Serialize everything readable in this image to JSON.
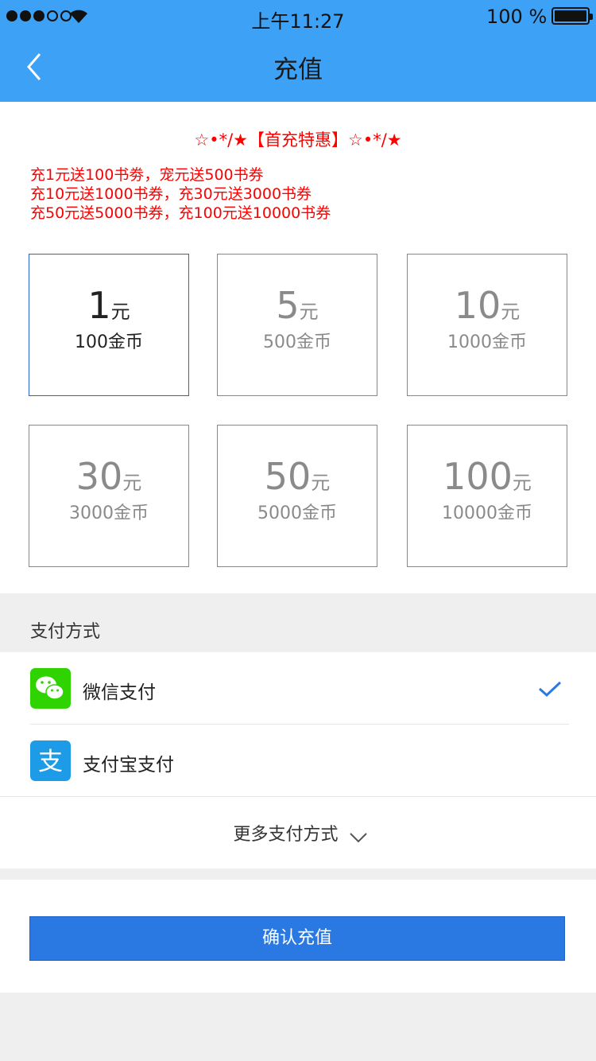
{
  "status_bar": {
    "time": "上午11:27",
    "battery_percent": "100 %",
    "signal_bars_filled": 3,
    "signal_bars_total": 5
  },
  "nav": {
    "title": "充值",
    "back_icon": "chevron-left-icon"
  },
  "promo": {
    "title": "☆•*/★【首充特惠】☆•*/★",
    "lines": [
      "充1元送100书劵，宠元送500书券",
      "充10元送1000书券，充30元送3000书券",
      "充50元送5000书券，充100元送10000书券"
    ]
  },
  "options": [
    {
      "amount": "1",
      "unit": "元",
      "coins": "100金币",
      "selected": true
    },
    {
      "amount": "5",
      "unit": "元",
      "coins": "500金币",
      "selected": false
    },
    {
      "amount": "10",
      "unit": "元",
      "coins": "1000金币",
      "selected": false
    },
    {
      "amount": "30",
      "unit": "元",
      "coins": "3000金币",
      "selected": false
    },
    {
      "amount": "50",
      "unit": "元",
      "coins": "5000金币",
      "selected": false
    },
    {
      "amount": "100",
      "unit": "元",
      "coins": "10000金币",
      "selected": false
    }
  ],
  "payment": {
    "section_label": "支付方式",
    "methods": [
      {
        "label": "微信支付",
        "icon": "wechat-icon",
        "selected": true
      },
      {
        "label": "支付宝支付",
        "icon": "alipay-icon",
        "selected": false
      }
    ],
    "more_label": "更多支付方式"
  },
  "confirm_label": "确认充值",
  "colors": {
    "header": "#3da1f6",
    "promo_text": "#ff0000",
    "selected_border": "#2a63c8",
    "confirm_button": "#2a79e3",
    "wechat": "#2fd400",
    "alipay": "#1e9be6",
    "check": "#2a79e3"
  }
}
